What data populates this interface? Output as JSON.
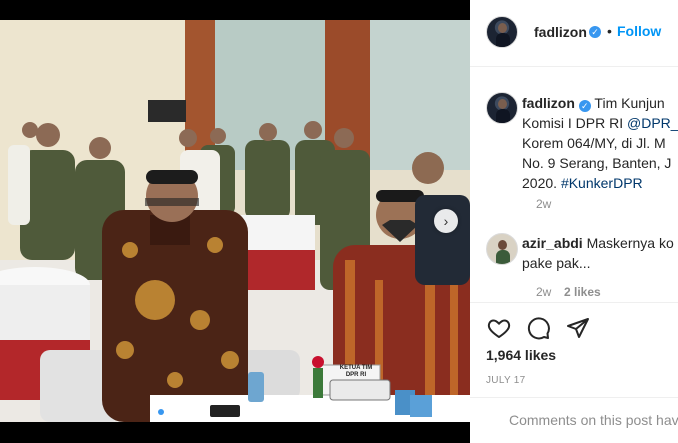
{
  "post": {
    "username": "fadlizon",
    "follow_label": "Follow",
    "separator": "•",
    "verified_mark": "✓",
    "caption_lines": [
      "Tim Kunjun",
      "Komisi I DPR RI",
      "Korem 064/MY, di Jl. M",
      "No. 9 Serang, Banten, J",
      "2020."
    ],
    "caption_mention": "@DPR_",
    "caption_hashtag": "#KunkerDPR",
    "caption_time": "2w",
    "likes": "1,964 likes",
    "date": "JULY 17",
    "comment_placeholder": "Comments on this post hav",
    "image_slide_count": 3,
    "image_active_slide": 1,
    "next_icon": "›",
    "podium_sign": "KETUA TIM DPR RI"
  },
  "comment": {
    "username": "azir_abdi",
    "text_line1": "Maskernya ko",
    "text_line2": "pake pak...",
    "time": "2w",
    "likes": "2 likes"
  },
  "colors": {
    "accent": "#0095f6",
    "verified": "#3897f0",
    "muted": "#8e8e8e",
    "text": "#262626"
  },
  "icons": [
    "heart-icon",
    "comment-icon",
    "share-icon",
    "verified-icon",
    "next-icon"
  ]
}
